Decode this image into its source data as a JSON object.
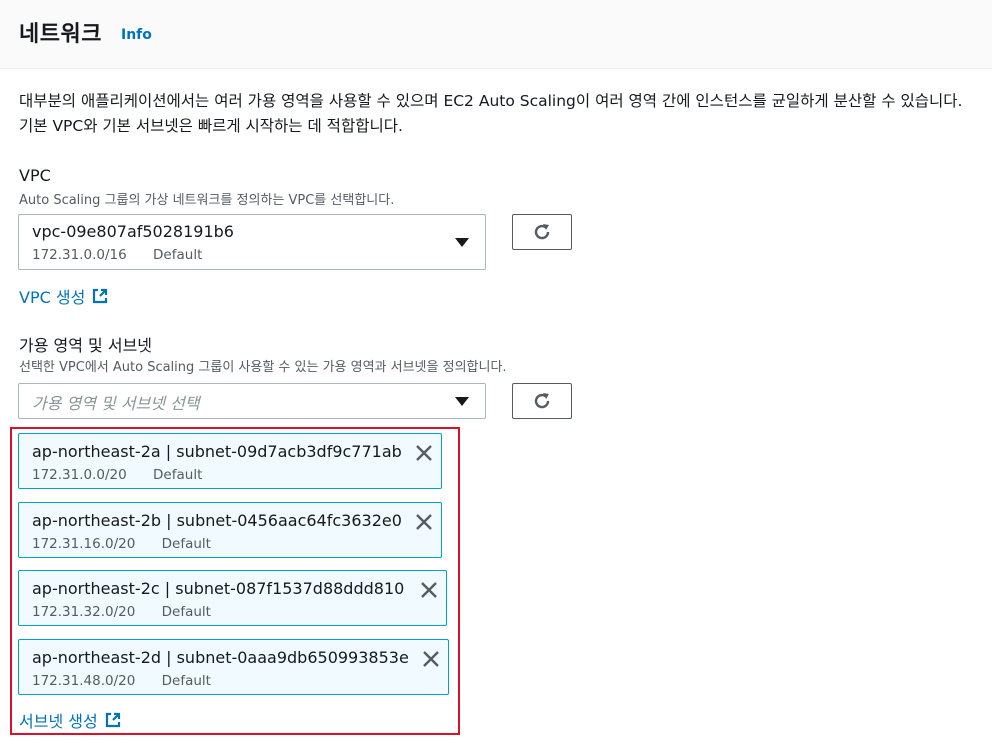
{
  "header": {
    "title": "네트워크",
    "info": "Info"
  },
  "description": "대부분의 애플리케이션에서는 여러 가용 영역을 사용할 수 있으며 EC2 Auto Scaling이 여러 영역 간에 인스턴스를 균일하게 분산할 수 있습니다. 기본 VPC와 기본 서브넷은 빠르게 시작하는 데 적합합니다.",
  "vpc": {
    "label": "VPC",
    "hint": "Auto Scaling 그룹의 가상 네트워크를 정의하는 VPC를 선택합니다.",
    "selected_id": "vpc-09e807af5028191b6",
    "selected_cidr": "172.31.0.0/16",
    "selected_tag": "Default",
    "create_link": "VPC 생성"
  },
  "subnets": {
    "label": "가용 영역 및 서브넷",
    "hint": "선택한 VPC에서 Auto Scaling 그룹이 사용할 수 있는 가용 영역과 서브넷을 정의합니다.",
    "placeholder": "가용 영역 및 서브넷 선택",
    "tokens": [
      {
        "name": "ap-northeast-2a | subnet-09d7acb3df9c771ab",
        "cidr": "172.31.0.0/20",
        "tag": "Default"
      },
      {
        "name": "ap-northeast-2b | subnet-0456aac64fc3632e0",
        "cidr": "172.31.16.0/20",
        "tag": "Default"
      },
      {
        "name": "ap-northeast-2c | subnet-087f1537d88ddd810",
        "cidr": "172.31.32.0/20",
        "tag": "Default"
      },
      {
        "name": "ap-northeast-2d | subnet-0aaa9db650993853e",
        "cidr": "172.31.48.0/20",
        "tag": "Default"
      }
    ],
    "create_link": "서브넷 생성"
  },
  "colors": {
    "link": "#0073bb",
    "token_border": "#00a1c9",
    "token_bg": "#f1faff",
    "highlight": "#d9112b"
  },
  "icons": {
    "refresh": "refresh-icon",
    "external": "external-link-icon",
    "remove": "close-icon",
    "dropdown": "caret-down-icon"
  }
}
